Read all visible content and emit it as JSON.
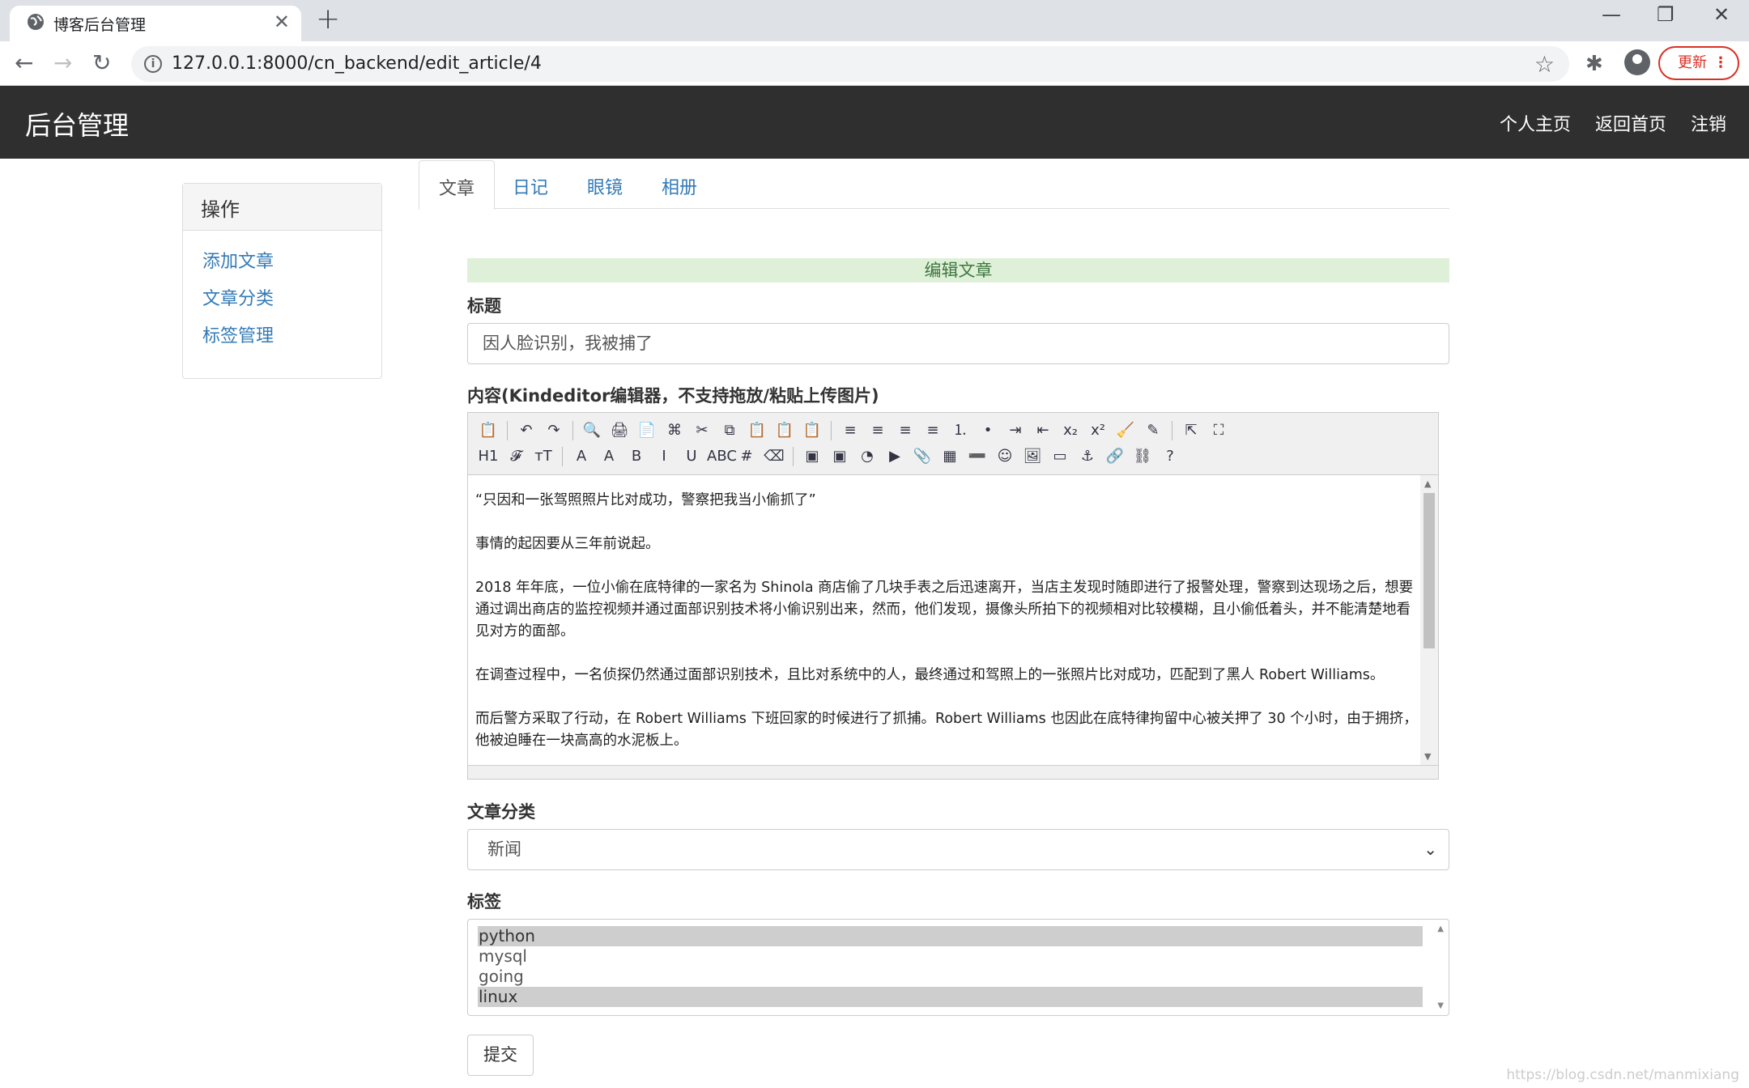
{
  "browser": {
    "tab_title": "博客后台管理",
    "url": "127.0.0.1:8000/cn_backend/edit_article/4",
    "update_label": "更新"
  },
  "navbar": {
    "brand": "后台管理",
    "links": [
      "个人主页",
      "返回首页",
      "注销"
    ]
  },
  "sidebar": {
    "heading": "操作",
    "items": [
      "添加文章",
      "文章分类",
      "标签管理"
    ]
  },
  "tabs": [
    "文章",
    "日记",
    "眼镜",
    "相册"
  ],
  "form": {
    "banner": "编辑文章",
    "title_label": "标题",
    "title_value": "因人脸识别，我被捕了",
    "content_label": "内容(Kindeditor编辑器，不支持拖放/粘贴上传图片)",
    "content_paragraphs": [
      "“只因和一张驾照照片比对成功，警察把我当小偷抓了”",
      "事情的起因要从三年前说起。",
      "2018 年年底，一位小偷在底特律的一家名为 Shinola 商店偷了几块手表之后迅速离开，当店主发现时随即进行了报警处理，警察到达现场之后，想要通过调出商店的监控视频并通过面部识别技术将小偷识别出来，然而，他们发现，摄像头所拍下的视频相对比较模糊，且小偷低着头，并不能清楚地看见对方的面部。",
      "在调查过程中，一名侦探仍然通过面部识别技术，且比对系统中的人，最终通过和驾照上的一张照片比对成功，匹配到了黑人 Robert Williams。",
      "而后警方采取了行动，在 Robert Williams 下班回家的时候进行了抓捕。Robert Williams 也因此在底特律拘留中心被关押了 30 个小时，由于拥挤，他被迫睡在一块高高的水泥板上。"
    ],
    "toolbar_row1": [
      "📋",
      "↶",
      "↷",
      "🔍",
      "🖨",
      "📄",
      "⌘",
      "✂",
      "⧉",
      "📋",
      "📋",
      "📋",
      "≡",
      "≡",
      "≡",
      "≡",
      "⒈",
      "•",
      "⇥",
      "⇤",
      "x₂",
      "x²",
      "🧹",
      "✎",
      "⇱",
      "⛶"
    ],
    "toolbar_row2": [
      "H1",
      "𝓕",
      "тT",
      "A",
      "A",
      "B",
      "I",
      "U",
      "ABC",
      "#",
      "⌫",
      "▣",
      "▣",
      "◔",
      "▶",
      "📎",
      "▦",
      "➖",
      "☺",
      "🖼",
      "▭",
      "⚓",
      "🔗",
      "⛓",
      "?"
    ],
    "category_label": "文章分类",
    "category_value": "新闻",
    "tags_label": "标签",
    "tags": [
      {
        "name": "python",
        "selected": true
      },
      {
        "name": "mysql",
        "selected": false
      },
      {
        "name": "going",
        "selected": false
      },
      {
        "name": "linux",
        "selected": true
      }
    ],
    "submit_label": "提交"
  },
  "watermark": "https://blog.csdn.net/manmixiang"
}
